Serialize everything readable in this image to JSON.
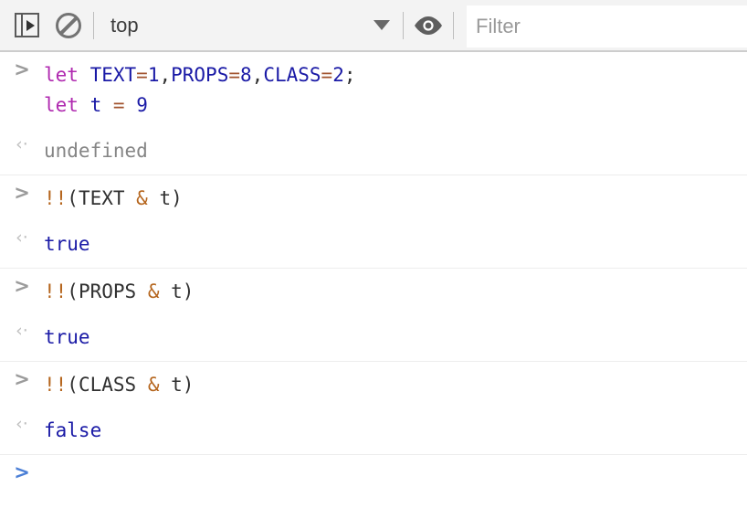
{
  "toolbar": {
    "sidebar_toggle": {
      "name": "show-console-sidebar",
      "title": "Show console sidebar"
    },
    "clear_console": {
      "name": "clear-console",
      "title": "Clear console"
    },
    "context": {
      "label": "top",
      "caret": "▼"
    },
    "live_expression": {
      "name": "create-live-expression",
      "title": "Create live expression"
    },
    "filter": {
      "value": "",
      "placeholder": "Filter"
    }
  },
  "console": {
    "prompt_symbol": ">",
    "return_symbol": "‹·",
    "entries": [
      {
        "type": "command",
        "lines": [
          [
            {
              "text": "let ",
              "cls": "tok-kw"
            },
            {
              "text": "TEXT",
              "cls": "tok-id"
            },
            {
              "text": "=",
              "cls": "tok-op"
            },
            {
              "text": "1",
              "cls": "tok-num"
            },
            {
              "text": ",",
              "cls": "tok-punc"
            },
            {
              "text": "PROPS",
              "cls": "tok-id"
            },
            {
              "text": "=",
              "cls": "tok-op"
            },
            {
              "text": "8",
              "cls": "tok-num"
            },
            {
              "text": ",",
              "cls": "tok-punc"
            },
            {
              "text": "CLASS",
              "cls": "tok-id"
            },
            {
              "text": "=",
              "cls": "tok-op"
            },
            {
              "text": "2",
              "cls": "tok-num"
            },
            {
              "text": ";",
              "cls": "tok-punc"
            }
          ],
          [
            {
              "text": "let ",
              "cls": "tok-kw"
            },
            {
              "text": "t",
              "cls": "tok-id"
            },
            {
              "text": " ",
              "cls": "tok-plain"
            },
            {
              "text": "=",
              "cls": "tok-op"
            },
            {
              "text": " ",
              "cls": "tok-plain"
            },
            {
              "text": "9",
              "cls": "tok-num"
            }
          ]
        ],
        "result": [
          {
            "text": "undefined",
            "cls": "val-undef"
          }
        ]
      },
      {
        "type": "command",
        "lines": [
          [
            {
              "text": "!!",
              "cls": "tok-bang"
            },
            {
              "text": "(TEXT ",
              "cls": "tok-plain"
            },
            {
              "text": "&",
              "cls": "tok-bang"
            },
            {
              "text": " t)",
              "cls": "tok-plain"
            }
          ]
        ],
        "result": [
          {
            "text": "true",
            "cls": "val-bool"
          }
        ]
      },
      {
        "type": "command",
        "lines": [
          [
            {
              "text": "!!",
              "cls": "tok-bang"
            },
            {
              "text": "(PROPS ",
              "cls": "tok-plain"
            },
            {
              "text": "&",
              "cls": "tok-bang"
            },
            {
              "text": " t)",
              "cls": "tok-plain"
            }
          ]
        ],
        "result": [
          {
            "text": "true",
            "cls": "val-bool"
          }
        ]
      },
      {
        "type": "command",
        "lines": [
          [
            {
              "text": "!!",
              "cls": "tok-bang"
            },
            {
              "text": "(CLASS ",
              "cls": "tok-plain"
            },
            {
              "text": "&",
              "cls": "tok-bang"
            },
            {
              "text": " t)",
              "cls": "tok-plain"
            }
          ]
        ],
        "result": [
          {
            "text": "false",
            "cls": "val-bool"
          }
        ]
      }
    ],
    "input_prompt": {
      "value": ""
    }
  },
  "colors": {
    "toolbar_bg": "#f3f3f3",
    "toolbar_border": "#cdcdcd",
    "row_rule": "#ededed",
    "keyword": "#b02ab0",
    "identifier": "#1a1aa6",
    "operator": "#a0522d",
    "number": "#1a1aa6",
    "bang_amp": "#b5651d",
    "boolean": "#1a1aa6",
    "undefined": "#858585",
    "prompt_gray": "#9b9b9b",
    "prompt_blue": "#4b7fd6",
    "return_arrow": "#bfbfbf",
    "plain_text": "#303030"
  }
}
